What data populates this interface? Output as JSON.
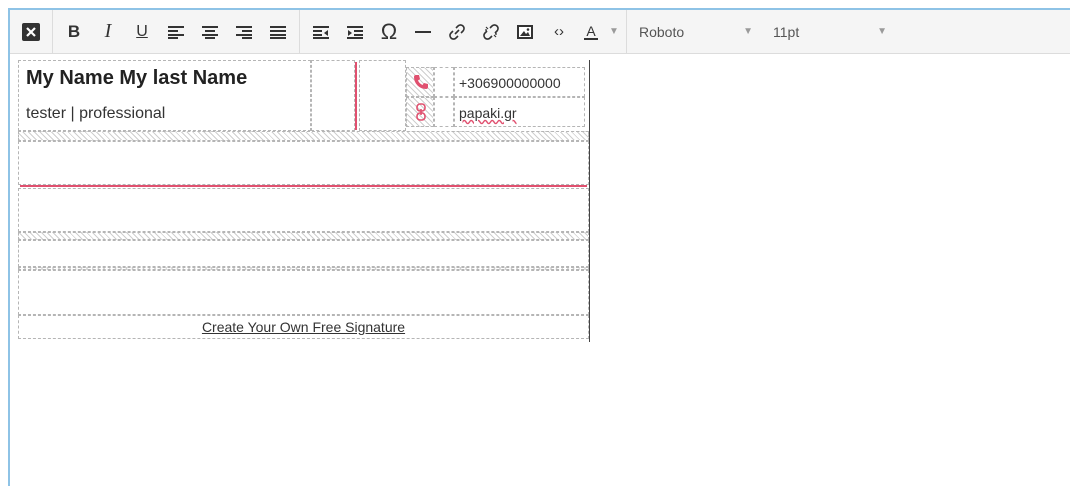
{
  "toolbar": {
    "font": "Roboto",
    "size": "11pt",
    "text_color_label": "A"
  },
  "signature": {
    "name": "My Name My last Name",
    "title": "tester | professional",
    "phone": "+306900000000",
    "website": "papaki.gr",
    "footer_link": "Create Your Own Free Signature"
  },
  "colors": {
    "accent": "#e0506f",
    "editor_border": "#8ec3e6"
  },
  "icons": [
    "close-icon",
    "bold-icon",
    "italic-icon",
    "underline-icon",
    "align-left-icon",
    "align-center-icon",
    "align-right-icon",
    "align-justify-icon",
    "outdent-icon",
    "indent-icon",
    "special-char-icon",
    "horizontal-line-icon",
    "link-icon",
    "unlink-icon",
    "image-icon",
    "code-icon",
    "text-color-icon",
    "phone-icon",
    "link-icon"
  ]
}
